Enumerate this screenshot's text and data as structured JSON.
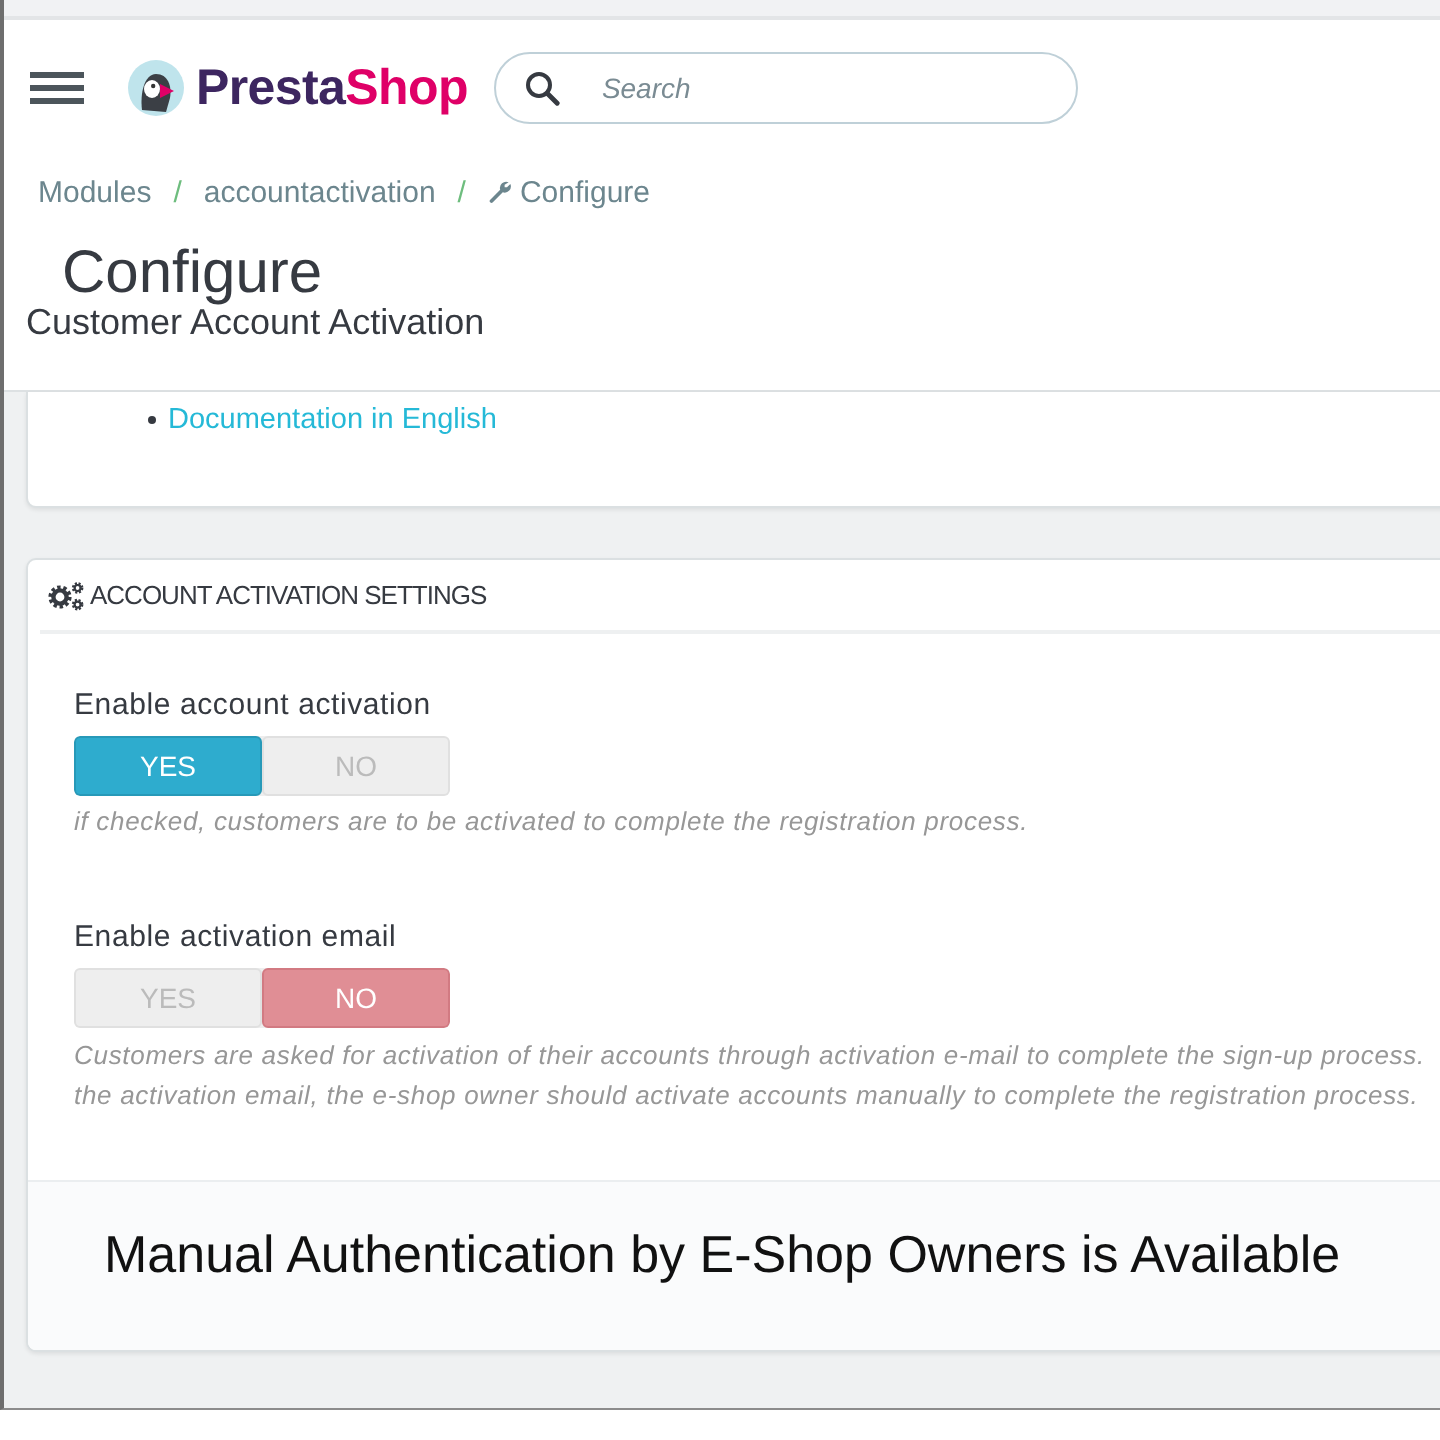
{
  "header": {
    "logo": {
      "parts": [
        {
          "text": "Presta",
          "color": "#3d2660"
        },
        {
          "text": "Shop",
          "color": "#df0067"
        }
      ]
    },
    "search": {
      "placeholder": "Search"
    }
  },
  "breadcrumb": [
    {
      "kind": "link",
      "text": "Modules"
    },
    {
      "kind": "separator",
      "text": "/"
    },
    {
      "kind": "link",
      "text": "accountactivation"
    },
    {
      "kind": "separator",
      "text": "/"
    },
    {
      "kind": "current",
      "text": "Configure"
    }
  ],
  "page_title": "Configure",
  "module_name": "Customer Account Activation",
  "documentation_card": {
    "links": [
      "Documentation in English"
    ]
  },
  "settings_panel": {
    "title": "ACCOUNT ACTIVATION SETTINGS",
    "fields": [
      {
        "label": "Enable account activation",
        "options": [
          {
            "kind": "yes",
            "text": "YES",
            "selected": true
          },
          {
            "kind": "no",
            "text": "NO",
            "selected": false
          }
        ],
        "help_lines": [
          "if checked, customers are to be activated to complete the registration process."
        ]
      },
      {
        "label": "Enable activation email",
        "options": [
          {
            "kind": "yes",
            "text": "YES",
            "selected": false
          },
          {
            "kind": "no",
            "text": "NO",
            "selected": true
          }
        ],
        "help_lines": [
          "Customers are asked for activation of their accounts through activation e-mail to complete the sign-up process.",
          "the activation email, the e-shop owner should activate accounts manually to complete the registration process."
        ]
      }
    ],
    "footer_text": "Manual Authentication by E-Shop Owners is Available"
  }
}
